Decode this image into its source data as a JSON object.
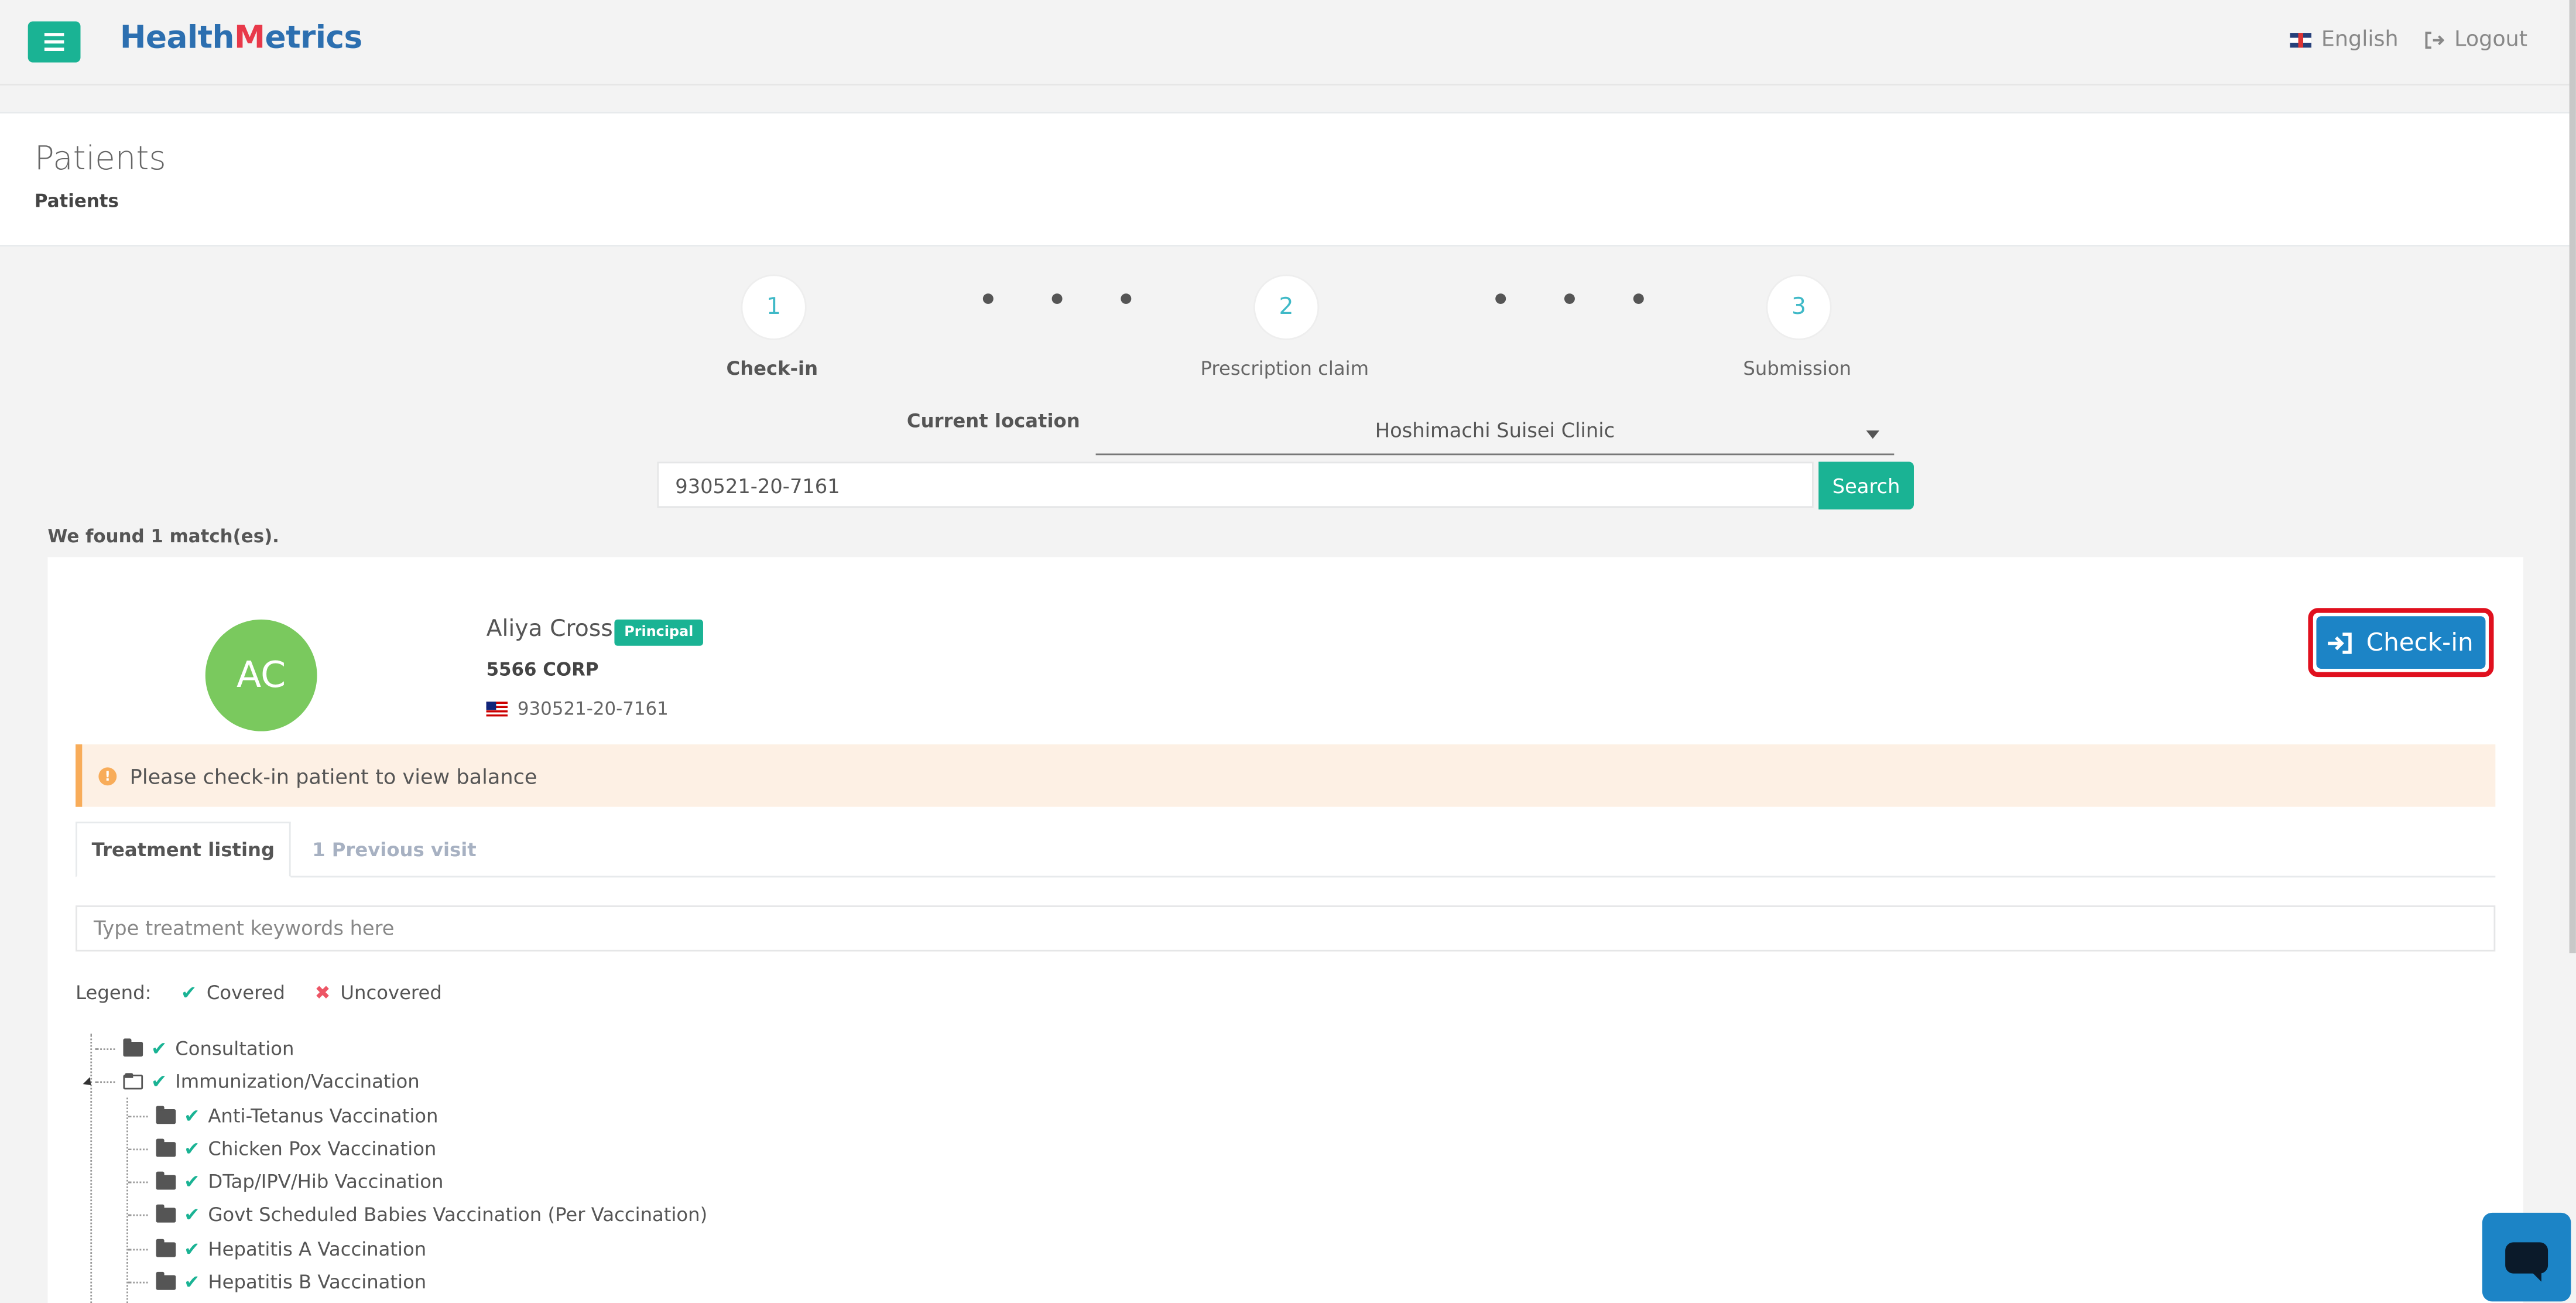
{
  "header": {
    "logo_prefix": "Health",
    "logo_m": "M",
    "logo_suffix": "etrics",
    "language": "English",
    "logout": "Logout"
  },
  "page": {
    "title": "Patients",
    "breadcrumb": "Patients"
  },
  "stepper": {
    "steps": [
      {
        "number": "1",
        "label": "Check-in"
      },
      {
        "number": "2",
        "label": "Prescription claim"
      },
      {
        "number": "3",
        "label": "Submission"
      }
    ],
    "separator": "• • •"
  },
  "location": {
    "label": "Current location",
    "selected": "Hoshimachi Suisei Clinic"
  },
  "search": {
    "value": "930521-20-7161",
    "button": "Search"
  },
  "results": {
    "summary": "We found 1 match(es)."
  },
  "patient": {
    "initials": "AC",
    "name": "Aliya Cross",
    "badge": "Principal",
    "company": "5566 CORP",
    "id_number": "930521-20-7161",
    "checkin_button": "Check-in"
  },
  "alert": {
    "icon": "!",
    "text": "Please check-in patient to view balance"
  },
  "tabs": [
    {
      "label": "Treatment listing"
    },
    {
      "label": "1 Previous visit"
    }
  ],
  "treatment_search": {
    "placeholder": "Type treatment keywords here"
  },
  "legend": {
    "label": "Legend:",
    "covered_icon": "✔",
    "covered": "Covered",
    "uncovered_icon": "✖",
    "uncovered": "Uncovered"
  },
  "tree": {
    "check_icon": "✔",
    "top": [
      {
        "label": "Consultation"
      },
      {
        "label": "Immunization/Vaccination"
      }
    ],
    "children": [
      {
        "label": "Anti-Tetanus Vaccination"
      },
      {
        "label": "Chicken Pox Vaccination"
      },
      {
        "label": "DTap/IPV/Hib Vaccination"
      },
      {
        "label": "Govt Scheduled Babies Vaccination (Per Vaccination)"
      },
      {
        "label": "Hepatitis A Vaccination"
      },
      {
        "label": "Hepatitis B Vaccination"
      }
    ]
  },
  "colors": {
    "primary": "#1ab394",
    "checkin_blue": "#1c84c6",
    "highlight_red": "#e0101e",
    "alert_bg": "#fdf0e4"
  }
}
